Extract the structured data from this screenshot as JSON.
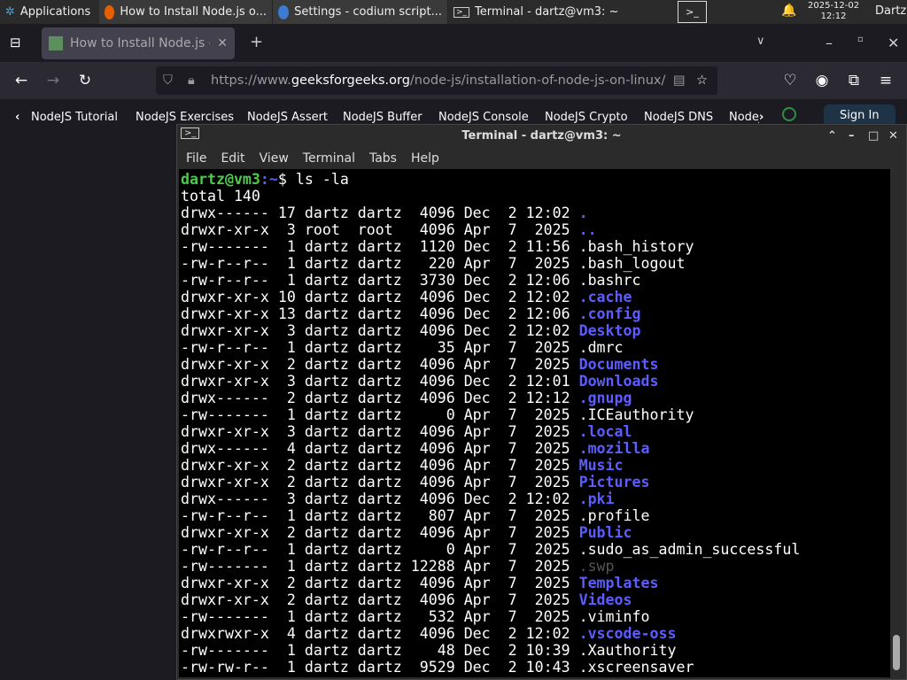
{
  "taskbar": {
    "applications": "Applications",
    "tasks": [
      "How to Install Node.js o...",
      "Settings - codium script...",
      "Terminal - dartz@vm3: ~"
    ],
    "date": "2025-12-02",
    "time": "12:12",
    "user": "Dartz"
  },
  "browser": {
    "tab_title": "How to Install Node.js on",
    "url_prefix": "https://www.",
    "url_domain": "geeksforgeeks.org",
    "url_path": "/node-js/installation-of-node-js-on-linux/",
    "bookmarks": [
      "NodeJS Tutorial",
      "NodeJS Exercises",
      "NodeJS Assert",
      "NodeJS Buffer",
      "NodeJS Console",
      "NodeJS Crypto",
      "NodeJS DNS",
      "NodeJ"
    ],
    "sign_in": "Sign In"
  },
  "terminal": {
    "title": "Terminal - dartz@vm3: ~",
    "menu": [
      "File",
      "Edit",
      "View",
      "Terminal",
      "Tabs",
      "Help"
    ],
    "prompt_user": "dartz@vm3",
    "prompt_path": ":~",
    "prompt_sym": "$ ",
    "command": "ls -la",
    "total": "total 140",
    "colors": {
      "dir": "#5c5cff",
      "prompt": "#4ec94e"
    },
    "lines": [
      {
        "meta": "drwx------ 17 dartz dartz  4096 Dec  2 12:02 ",
        "name": ".",
        "type": "dir"
      },
      {
        "meta": "drwxr-xr-x  3 root  root   4096 Apr  7  2025 ",
        "name": "..",
        "type": "dir"
      },
      {
        "meta": "-rw-------  1 dartz dartz  1120 Dec  2 11:56 ",
        "name": ".bash_history",
        "type": "file"
      },
      {
        "meta": "-rw-r--r--  1 dartz dartz   220 Apr  7  2025 ",
        "name": ".bash_logout",
        "type": "file"
      },
      {
        "meta": "-rw-r--r--  1 dartz dartz  3730 Dec  2 12:06 ",
        "name": ".bashrc",
        "type": "file"
      },
      {
        "meta": "drwxr-xr-x 10 dartz dartz  4096 Dec  2 12:02 ",
        "name": ".cache",
        "type": "dir"
      },
      {
        "meta": "drwxr-xr-x 13 dartz dartz  4096 Dec  2 12:06 ",
        "name": ".config",
        "type": "dir"
      },
      {
        "meta": "drwxr-xr-x  3 dartz dartz  4096 Dec  2 12:02 ",
        "name": "Desktop",
        "type": "dir"
      },
      {
        "meta": "-rw-r--r--  1 dartz dartz    35 Apr  7  2025 ",
        "name": ".dmrc",
        "type": "file"
      },
      {
        "meta": "drwxr-xr-x  2 dartz dartz  4096 Apr  7  2025 ",
        "name": "Documents",
        "type": "dir"
      },
      {
        "meta": "drwxr-xr-x  3 dartz dartz  4096 Dec  2 12:01 ",
        "name": "Downloads",
        "type": "dir"
      },
      {
        "meta": "drwx------  2 dartz dartz  4096 Dec  2 12:12 ",
        "name": ".gnupg",
        "type": "dir"
      },
      {
        "meta": "-rw-------  1 dartz dartz     0 Apr  7  2025 ",
        "name": ".ICEauthority",
        "type": "file"
      },
      {
        "meta": "drwxr-xr-x  3 dartz dartz  4096 Apr  7  2025 ",
        "name": ".local",
        "type": "dir"
      },
      {
        "meta": "drwx------  4 dartz dartz  4096 Apr  7  2025 ",
        "name": ".mozilla",
        "type": "dir"
      },
      {
        "meta": "drwxr-xr-x  2 dartz dartz  4096 Apr  7  2025 ",
        "name": "Music",
        "type": "dir"
      },
      {
        "meta": "drwxr-xr-x  2 dartz dartz  4096 Apr  7  2025 ",
        "name": "Pictures",
        "type": "dir"
      },
      {
        "meta": "drwx------  3 dartz dartz  4096 Dec  2 12:02 ",
        "name": ".pki",
        "type": "dir"
      },
      {
        "meta": "-rw-r--r--  1 dartz dartz   807 Apr  7  2025 ",
        "name": ".profile",
        "type": "file"
      },
      {
        "meta": "drwxr-xr-x  2 dartz dartz  4096 Apr  7  2025 ",
        "name": "Public",
        "type": "dir"
      },
      {
        "meta": "-rw-r--r--  1 dartz dartz     0 Apr  7  2025 ",
        "name": ".sudo_as_admin_successful",
        "type": "file"
      },
      {
        "meta": "-rw-------  1 dartz dartz 12288 Apr  7  2025 ",
        "name": ".swp",
        "type": "dim"
      },
      {
        "meta": "drwxr-xr-x  2 dartz dartz  4096 Apr  7  2025 ",
        "name": "Templates",
        "type": "dir"
      },
      {
        "meta": "drwxr-xr-x  2 dartz dartz  4096 Apr  7  2025 ",
        "name": "Videos",
        "type": "dir"
      },
      {
        "meta": "-rw-------  1 dartz dartz   532 Apr  7  2025 ",
        "name": ".viminfo",
        "type": "file"
      },
      {
        "meta": "drwxrwxr-x  4 dartz dartz  4096 Dec  2 12:02 ",
        "name": ".vscode-oss",
        "type": "dir"
      },
      {
        "meta": "-rw-------  1 dartz dartz    48 Dec  2 10:39 ",
        "name": ".Xauthority",
        "type": "file"
      },
      {
        "meta": "-rw-rw-r--  1 dartz dartz  9529 Dec  2 10:43 ",
        "name": ".xscreensaver",
        "type": "file"
      }
    ]
  }
}
